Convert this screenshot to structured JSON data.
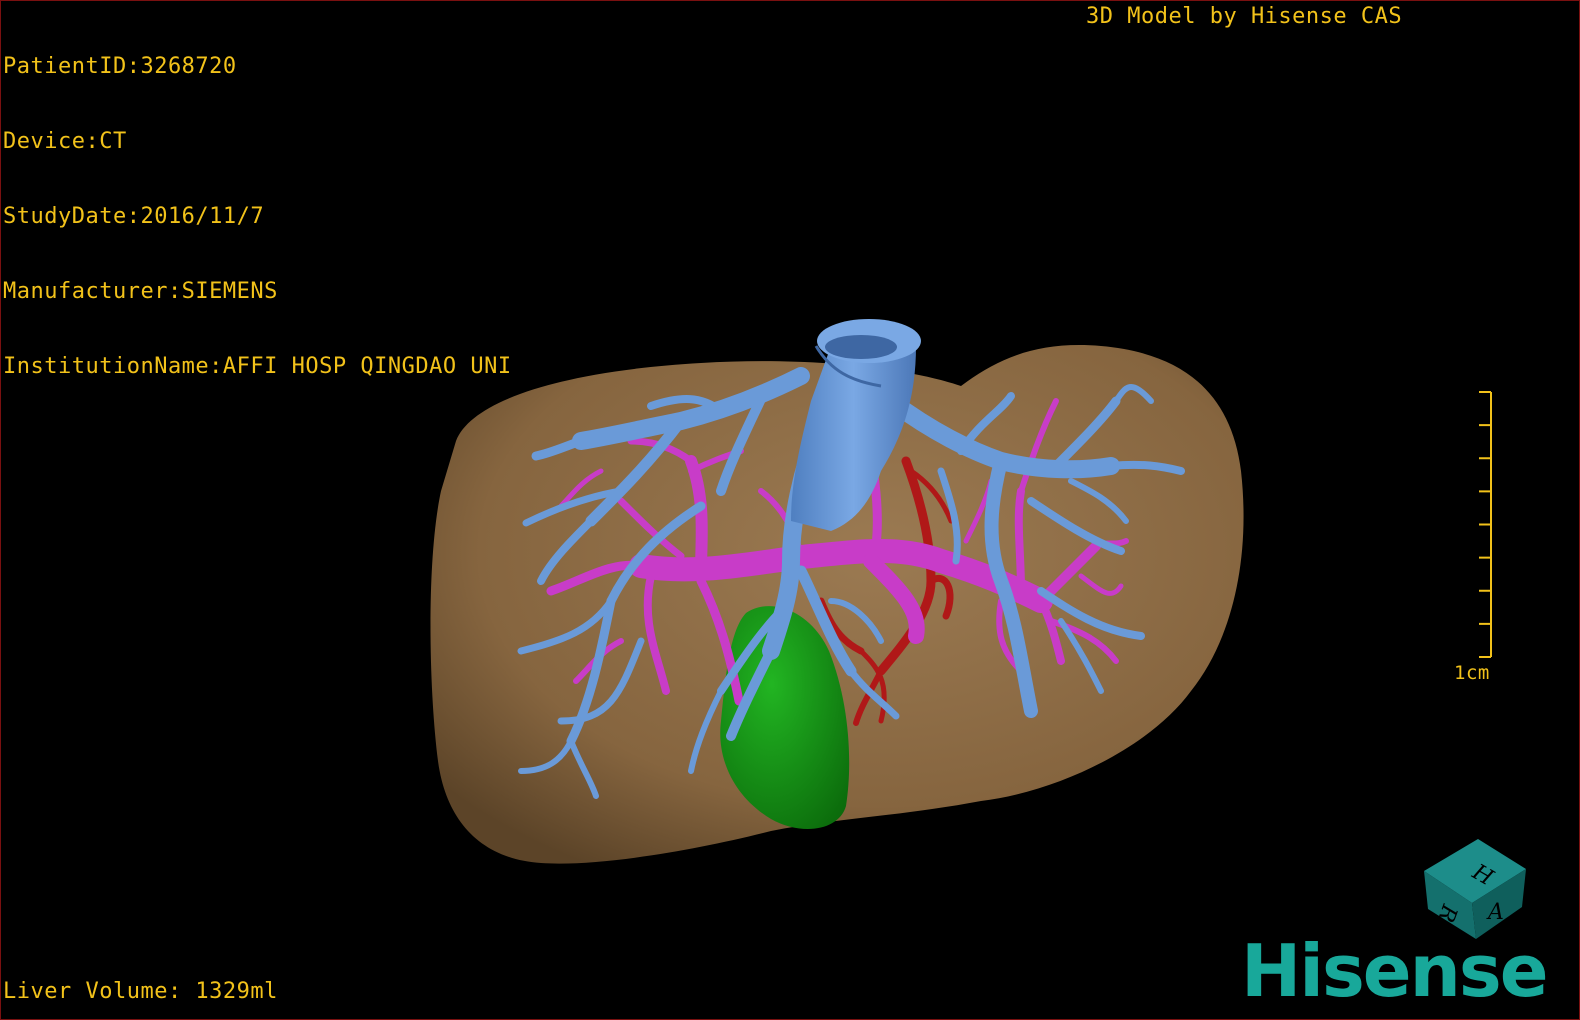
{
  "dicom": {
    "patient_id": "PatientID:3268720",
    "device": "Device:CT",
    "study_date": "StudyDate:2016/11/7",
    "manufacturer": "Manufacturer:SIEMENS",
    "institution": "InstitutionName:AFFI HOSP QINGDAO UNI"
  },
  "credit": "3D Model by Hisense CAS",
  "liver_volume": "Liver Volume: 1329ml",
  "scale_bar": {
    "label": "1cm",
    "ticks": 8
  },
  "brand": "Hisense",
  "orientation_cube": {
    "face_labels": [
      "H",
      "R",
      "A"
    ]
  },
  "colors": {
    "overlay_text": "#f2c21a",
    "liver": "#8a6a45",
    "hepatic_vein": "#6a9ad8",
    "portal_vein": "#c83cc8",
    "artery": "#b01818",
    "gallbladder": "#1a9a1a",
    "brand": "#18a89a",
    "border": "#7a1010"
  }
}
